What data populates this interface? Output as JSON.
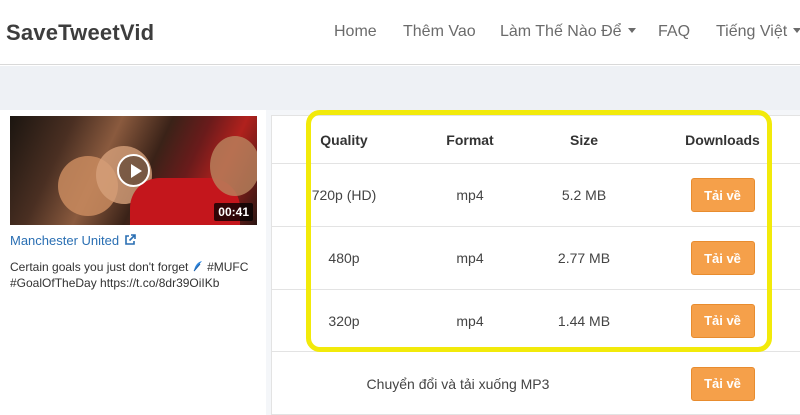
{
  "nav": {
    "brand": "SaveTweetVid",
    "home": "Home",
    "them_vao": "Thêm Vao",
    "how_to": "Làm Thế Nào Để",
    "faq": "FAQ",
    "language": "Tiếng Việt"
  },
  "tweet": {
    "duration": "00:41",
    "account": "Manchester United",
    "text_line1": "Certain goals you just don't forget",
    "hashtag1": "#MUFC",
    "text_line2": "#GoalOfTheDay https://t.co/8dr39OiIKb"
  },
  "table": {
    "headers": {
      "quality": "Quality",
      "format": "Format",
      "size": "Size",
      "downloads": "Downloads"
    },
    "rows": [
      {
        "quality": "720p (HD)",
        "format": "mp4",
        "size": "5.2 MB",
        "button": "Tải về"
      },
      {
        "quality": "480p",
        "format": "mp4",
        "size": "2.77 MB",
        "button": "Tải về"
      },
      {
        "quality": "320p",
        "format": "mp4",
        "size": "1.44 MB",
        "button": "Tải về"
      }
    ],
    "mp3": {
      "label": "Chuyển đổi và tải xuống MP3",
      "button": "Tải về"
    }
  },
  "colors": {
    "accent_button": "#f5a04a",
    "link": "#2a6fb3",
    "highlight": "#f2ea0a"
  }
}
